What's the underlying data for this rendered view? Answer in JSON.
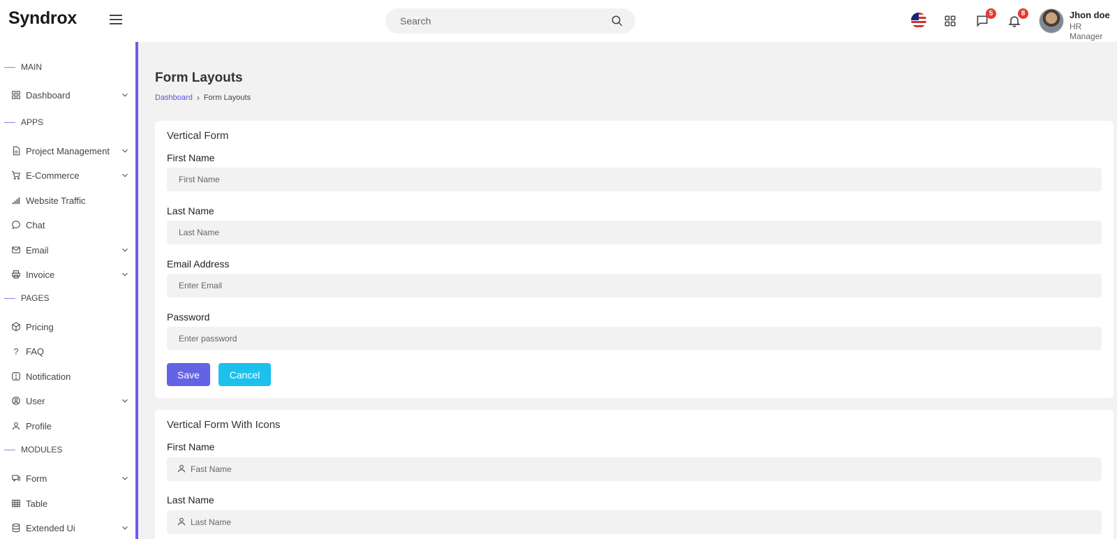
{
  "brand": "Syndrox",
  "search": {
    "placeholder": "Search"
  },
  "header": {
    "messages_badge": "5",
    "notifications_badge": "8",
    "user": {
      "name": "Jhon doe",
      "role": "HR Manager"
    }
  },
  "sidebar": {
    "sections": {
      "main": "MAIN",
      "apps": "APPS",
      "pages": "PAGES",
      "modules": "MODULES"
    },
    "items": {
      "dashboard": "Dashboard",
      "project_management": "Project Management",
      "ecommerce": "E-Commerce",
      "website_traffic": "Website Traffic",
      "chat": "Chat",
      "email": "Email",
      "invoice": "Invoice",
      "pricing": "Pricing",
      "faq": "FAQ",
      "notification": "Notification",
      "user": "User",
      "profile": "Profile",
      "form": "Form",
      "table": "Table",
      "extended_ui": "Extended Ui"
    }
  },
  "page": {
    "title": "Form Layouts",
    "breadcrumb": {
      "home": "Dashboard",
      "current": "Form Layouts"
    }
  },
  "vertical_form": {
    "title": "Vertical Form",
    "first_name": {
      "label": "First Name",
      "placeholder": "First Name"
    },
    "last_name": {
      "label": "Last Name",
      "placeholder": "Last Name"
    },
    "email": {
      "label": "Email Address",
      "placeholder": "Enter Email"
    },
    "password": {
      "label": "Password",
      "placeholder": "Enter password"
    },
    "save_label": "Save",
    "cancel_label": "Cancel"
  },
  "vertical_form_icons": {
    "title": "Vertical Form With Icons",
    "first_name": {
      "label": "First Name",
      "placeholder": "Fast Name"
    },
    "last_name": {
      "label": "Last Name",
      "placeholder": "Last Name"
    }
  },
  "colors": {
    "accent": "#6c5ce7",
    "save": "#6363e6",
    "cancel": "#1cc0ec",
    "badge": "#e53935"
  }
}
